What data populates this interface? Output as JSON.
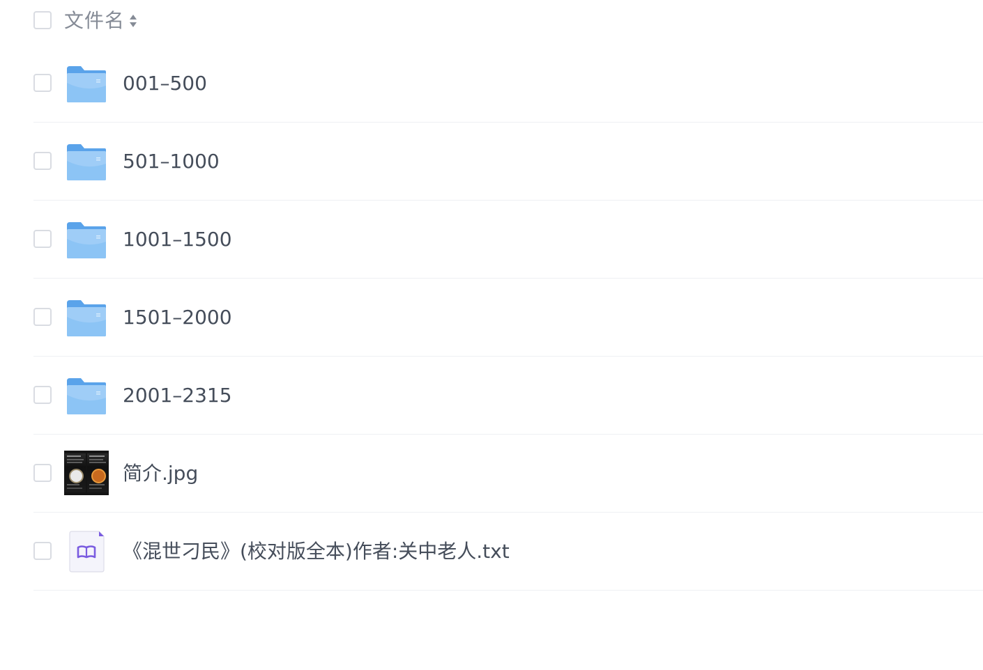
{
  "header": {
    "column_label": "文件名"
  },
  "files": [
    {
      "type": "folder",
      "name": "001–500"
    },
    {
      "type": "folder",
      "name": "501–1000"
    },
    {
      "type": "folder",
      "name": "1001–1500"
    },
    {
      "type": "folder",
      "name": "1501–2000"
    },
    {
      "type": "folder",
      "name": "2001–2315"
    },
    {
      "type": "image",
      "name": "简介.jpg"
    },
    {
      "type": "text",
      "name": "《混世刁民》(校对版全本)作者:关中老人.txt"
    }
  ],
  "colors": {
    "folder": "#7ab8f0",
    "text_primary": "#454d5a",
    "header_text": "#858b96",
    "divider": "#eef0f3",
    "txt_accent": "#7a5ce0"
  }
}
